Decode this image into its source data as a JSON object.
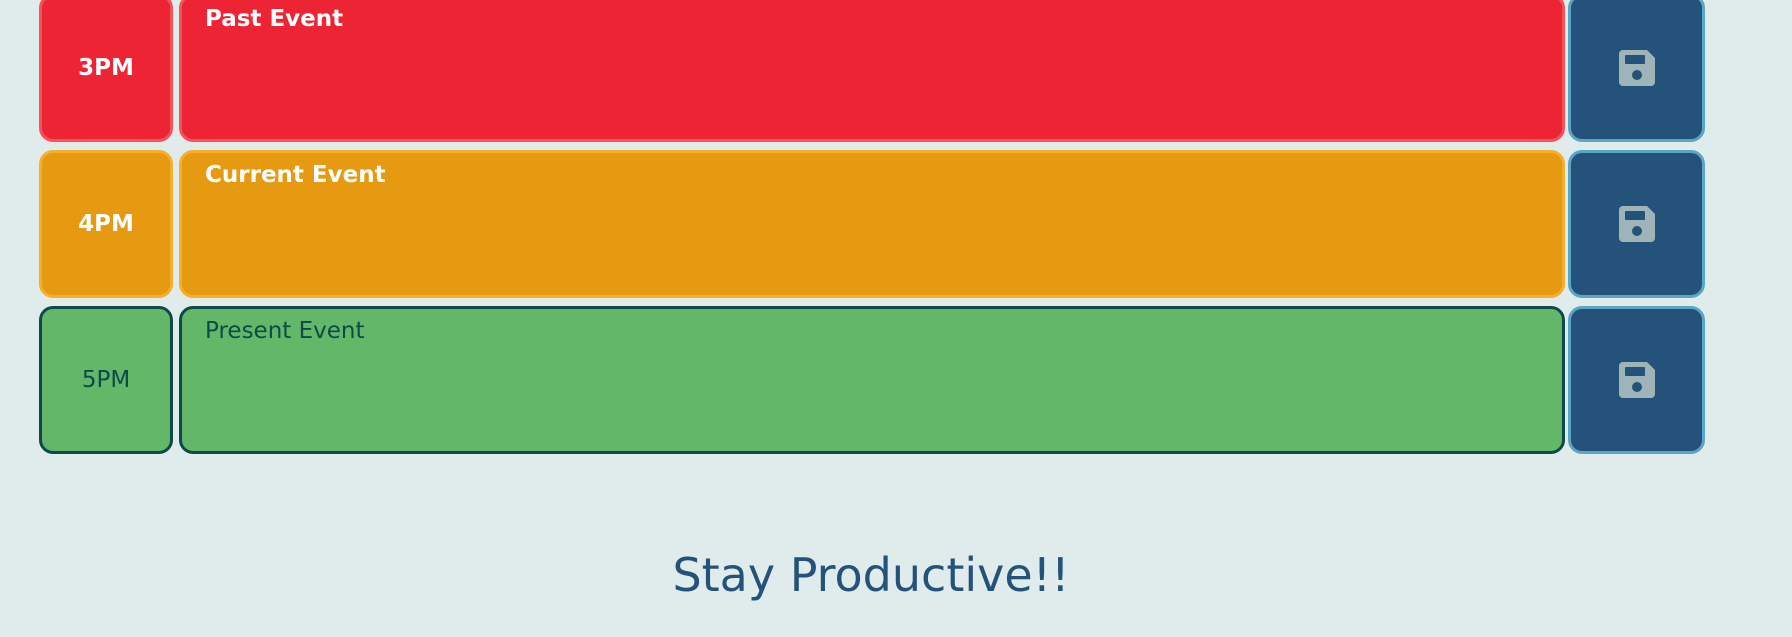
{
  "rows": [
    {
      "hour": "3PM",
      "event": "Past Event",
      "state": "past"
    },
    {
      "hour": "4PM",
      "event": "Current Event",
      "state": "present"
    },
    {
      "hour": "5PM",
      "event": "Present Event",
      "state": "future"
    }
  ],
  "save_icon": "floppy-disk-icon",
  "footer": {
    "text": "Stay Productive!!"
  },
  "colors": {
    "background": "#e0ecec",
    "past": "#ec2434",
    "present": "#e59a11",
    "future": "#62b868",
    "save_button": "#24527a",
    "save_icon": "#9fb4b8",
    "footer_text": "#24527a"
  }
}
